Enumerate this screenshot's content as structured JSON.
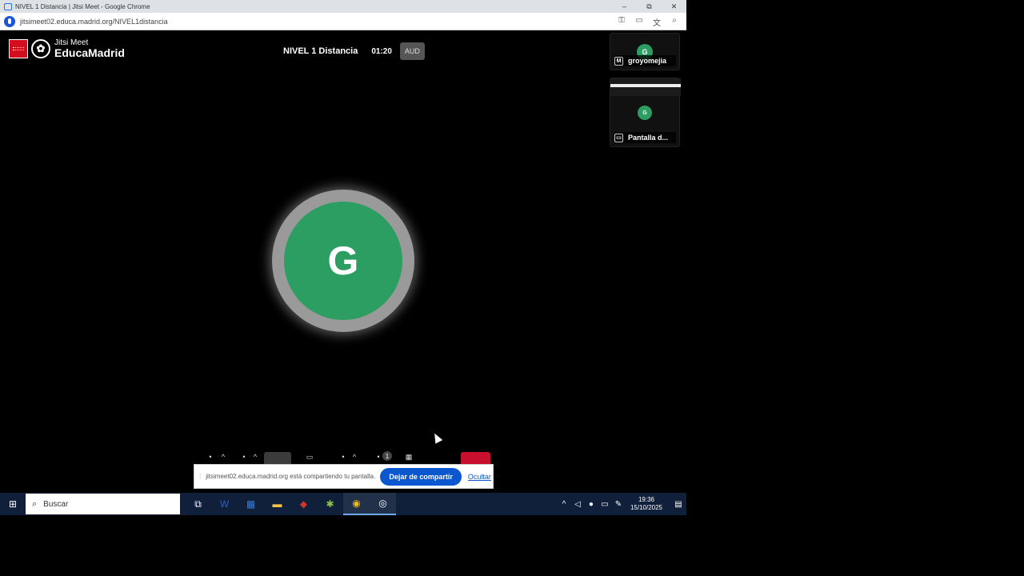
{
  "window": {
    "title": "NIVEL 1 Distancia | Jitsi Meet - Google Chrome",
    "controls": {
      "minimize": "–",
      "restore": "⧉",
      "close": "✕"
    }
  },
  "address_bar": {
    "url": "jitsimeet02.educa.madrid.org/NIVEL1distancia",
    "icons": [
      "key-icon",
      "cast-icon",
      "translate-icon",
      "zoom-icon"
    ]
  },
  "logo": {
    "top": "Jitsi Meet",
    "bottom": "EducaMadrid"
  },
  "meeting": {
    "name": "NIVEL 1 Distancia",
    "timer": "01:20",
    "badge": "AUD"
  },
  "main_avatar": {
    "initial": "G",
    "color": "#2d9e62"
  },
  "filmstrip": [
    {
      "initial": "G",
      "badge": "M",
      "label": "groyomejia"
    },
    {
      "initial": "G",
      "label": "Pantalla d..."
    }
  ],
  "toolbar": {
    "participants_count": "1",
    "hangup_color": "#c8102e"
  },
  "share_banner": {
    "message": "jitsimeet02.educa.madrid.org está compartiendo tu pantalla.",
    "stop_label": "Dejar de compartir",
    "hide_label": "Ocultar"
  },
  "taskbar": {
    "search_placeholder": "Buscar",
    "apps": [
      "task-view-icon",
      "word-icon",
      "calculator-icon",
      "file-explorer-icon",
      "security-icon",
      "settings-icon",
      "chrome-icon",
      "recorder-icon"
    ],
    "time": "19:36",
    "date": "15/10/2025"
  },
  "colors": {
    "accent": "#0b57d0",
    "taskbar": "#10203b"
  }
}
